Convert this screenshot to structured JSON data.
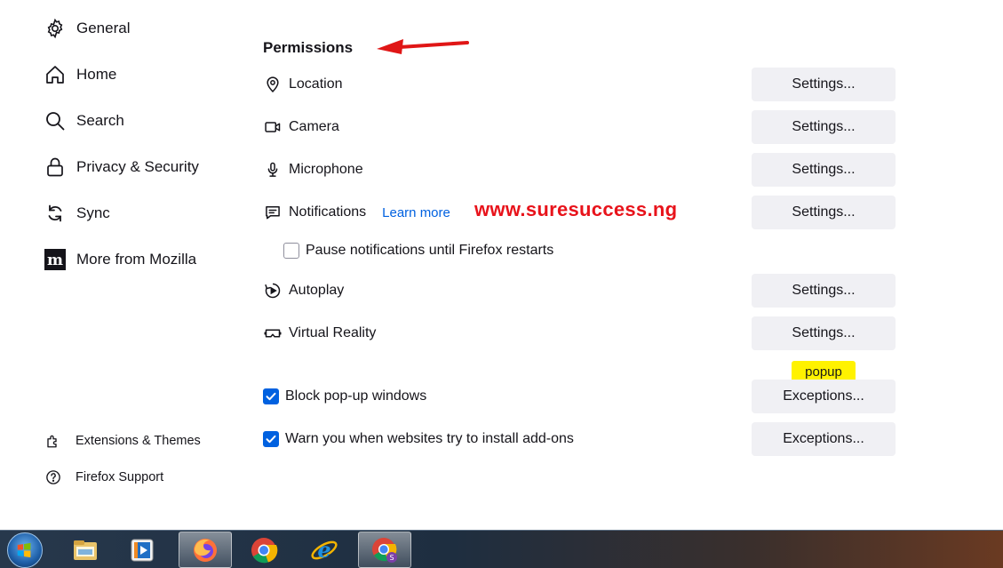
{
  "sidebar": {
    "items": [
      {
        "label": "General",
        "icon": "gear-icon"
      },
      {
        "label": "Home",
        "icon": "home-icon"
      },
      {
        "label": "Search",
        "icon": "search-icon"
      },
      {
        "label": "Privacy & Security",
        "icon": "lock-icon"
      },
      {
        "label": "Sync",
        "icon": "sync-icon"
      },
      {
        "label": "More from Mozilla",
        "icon": "mozilla-icon"
      }
    ],
    "footer": [
      {
        "label": "Extensions & Themes",
        "icon": "puzzle-icon"
      },
      {
        "label": "Firefox Support",
        "icon": "help-icon"
      }
    ]
  },
  "permissions": {
    "title": "Permissions",
    "rows": [
      {
        "label": "Location",
        "icon": "location-icon",
        "button": "Settings..."
      },
      {
        "label": "Camera",
        "icon": "camera-icon",
        "button": "Settings..."
      },
      {
        "label": "Microphone",
        "icon": "microphone-icon",
        "button": "Settings..."
      },
      {
        "label": "Notifications",
        "icon": "notification-icon",
        "button": "Settings...",
        "link": "Learn more"
      },
      {
        "label": "Autoplay",
        "icon": "autoplay-icon",
        "button": "Settings..."
      },
      {
        "label": "Virtual Reality",
        "icon": "vr-icon",
        "button": "Settings..."
      }
    ],
    "pause_notifications": {
      "label": "Pause notifications until Firefox restarts",
      "checked": false
    },
    "block_popups": {
      "label": "Block pop-up windows",
      "checked": true,
      "button": "Exceptions..."
    },
    "warn_addons": {
      "label": "Warn you when websites try to install add-ons",
      "checked": true,
      "button": "Exceptions..."
    }
  },
  "annotations": {
    "watermark": "www.suresuccess.ng",
    "popup_note": "popup"
  },
  "taskbar": {
    "items": [
      "start-button",
      "file-explorer-icon",
      "media-player-icon",
      "firefox-icon",
      "chrome-icon",
      "internet-explorer-icon",
      "chrome-profile-icon"
    ]
  },
  "colors": {
    "accent": "#0061e0",
    "button_bg": "#f0f0f4",
    "annotation_red": "#e8131b",
    "annotation_yellow": "#fff200"
  }
}
